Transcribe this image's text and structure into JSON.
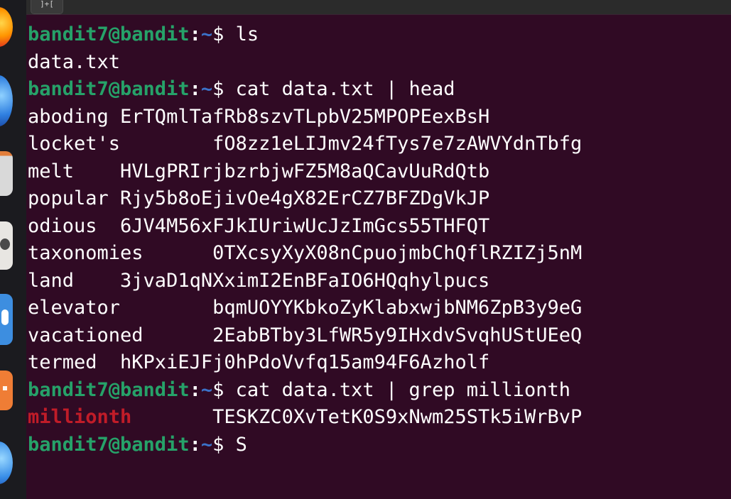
{
  "window": {
    "tab_button_label": "]+["
  },
  "dock": {
    "items": [
      "firefox-icon",
      "browser-icon",
      "files-icon",
      "disc-icon",
      "software-icon",
      "help-icon",
      "web-icon"
    ]
  },
  "colors": {
    "background": "#300a24",
    "prompt_user": "#26a269",
    "prompt_path": "#3b72c9",
    "match_highlight": "#c01c28",
    "text": "#ffffff"
  },
  "prompt": {
    "user_host": "bandit7@bandit",
    "separator": ":",
    "path": "~",
    "symbol": "$ "
  },
  "lines": [
    {
      "type": "prompt",
      "command": "ls"
    },
    {
      "type": "output",
      "text": "data.txt"
    },
    {
      "type": "prompt",
      "command": "cat data.txt | head"
    },
    {
      "type": "output",
      "text": "aboding ErTQmlTafRb8szvTLpbV25MPOPEexBsH"
    },
    {
      "type": "output",
      "text": "locket's        fO8zz1eLIJmv24fTys7e7zAWVYdnTbfg"
    },
    {
      "type": "output",
      "text": "melt    HVLgPRIrjbzrbjwFZ5M8aQCavUuRdQtb"
    },
    {
      "type": "output",
      "text": "popular Rjy5b8oEjivOe4gX82ErCZ7BFZDgVkJP"
    },
    {
      "type": "output",
      "text": "odious  6JV4M56xFJkIUriwUcJzImGcs55THFQT"
    },
    {
      "type": "output",
      "text": "taxonomies      0TXcsyXyX08nCpuojmbChQflRZIZj5nM"
    },
    {
      "type": "output",
      "text": "land    3jvaD1qNXximI2EnBFaIO6HQqhylpucs"
    },
    {
      "type": "output",
      "text": "elevator        bqmUOYYKbkoZyKlabxwjbNM6ZpB3y9eG"
    },
    {
      "type": "output",
      "text": "vacationed      2EabBTby3LfWR5y9IHxdvSvqhUStUEeQ"
    },
    {
      "type": "output",
      "text": "termed  hKPxiEJFj0hPdoVvfq15am94F6Azholf"
    },
    {
      "type": "prompt",
      "command": "cat data.txt | grep millionth"
    },
    {
      "type": "match",
      "match": "millionth",
      "rest": "       TESKZC0XvTetK0S9xNwm25STk5iWrBvP"
    },
    {
      "type": "prompt",
      "command": "S"
    }
  ]
}
